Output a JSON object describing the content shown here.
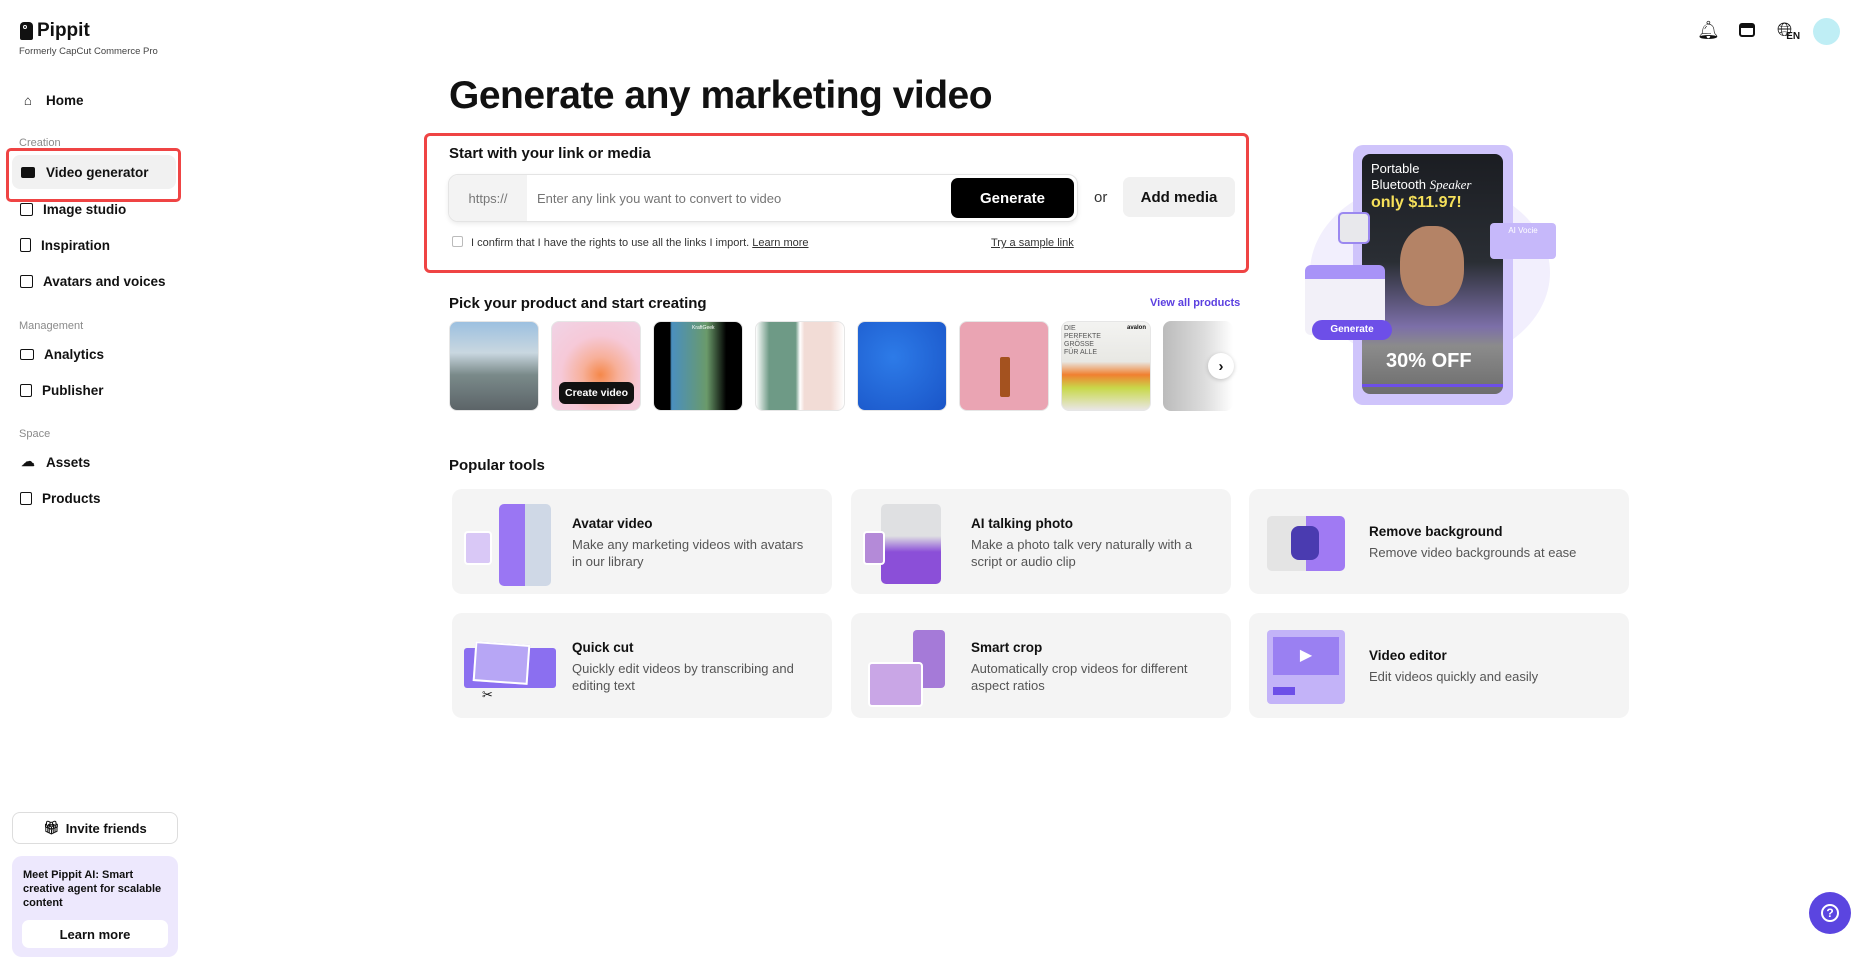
{
  "brand": {
    "name": "Pippit",
    "tagline": "Formerly CapCut Commerce Pro"
  },
  "sidebar": {
    "home": "Home",
    "sections": [
      {
        "label": "Creation",
        "items": [
          "Video generator",
          "Image studio",
          "Inspiration",
          "Avatars and voices"
        ]
      },
      {
        "label": "Management",
        "items": [
          "Analytics",
          "Publisher"
        ]
      },
      {
        "label": "Space",
        "items": [
          "Assets",
          "Products"
        ]
      }
    ],
    "invite": "Invite friends",
    "promo": {
      "bold": "Meet Pippit AI:",
      "text": " Smart creative agent for scalable content",
      "button": "Learn more"
    }
  },
  "header": {
    "language": "EN"
  },
  "main": {
    "title": "Generate any marketing video",
    "link_section": {
      "heading": "Start with your link or media",
      "prefix": "https://",
      "placeholder": "Enter any link you want to convert to video",
      "generate": "Generate",
      "or": "or",
      "add_media": "Add media",
      "confirm": "I confirm that I have the rights to use all the links I import.",
      "learn_more": "Learn more",
      "sample": "Try a sample link"
    },
    "products": {
      "heading": "Pick your product and start creating",
      "view_all": "View all products",
      "create_video": "Create video",
      "thumb_texts": [
        "KraftGeek",
        "DIE PERFEKTE GRÖSSE FÜR ALLE",
        "avalon"
      ]
    },
    "promo_art": {
      "line1": "Portable",
      "line2": "Bluetooth",
      "line2b": "Speaker",
      "price": "only $11.97!",
      "voice": "AI Vocie",
      "generate": "Generate",
      "discount": "30% OFF"
    },
    "popular": {
      "heading": "Popular tools",
      "tools": [
        {
          "title": "Avatar video",
          "desc": "Make any marketing videos with avatars in our library"
        },
        {
          "title": "AI talking photo",
          "desc": "Make a photo talk very naturally with a script or audio clip"
        },
        {
          "title": "Remove background",
          "desc": "Remove video backgrounds at ease"
        },
        {
          "title": "Quick cut",
          "desc": "Quickly edit videos by transcribing and editing text"
        },
        {
          "title": "Smart crop",
          "desc": "Automatically crop videos for different aspect ratios"
        },
        {
          "title": "Video editor",
          "desc": "Edit videos quickly and easily"
        }
      ]
    }
  },
  "colors": {
    "accent": "#6d4fe8",
    "highlight": "#ef4444",
    "purple_light": "#cfc4fb"
  }
}
